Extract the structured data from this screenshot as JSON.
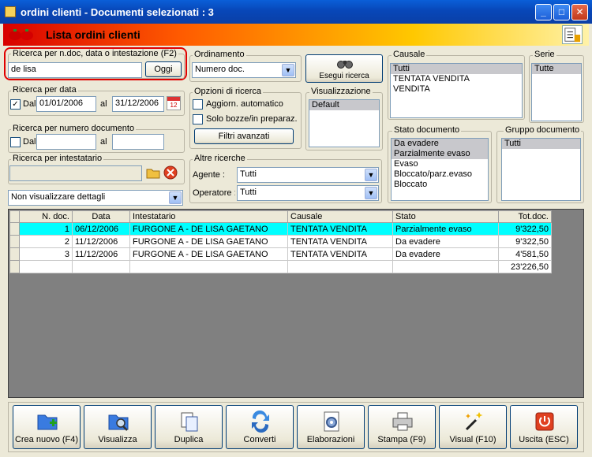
{
  "window": {
    "title": "ordini clienti - Documenti selezionati : 3",
    "controls": {
      "minimize": "_",
      "maximize": "□",
      "close": "✕"
    }
  },
  "header": {
    "title": "Lista ordini clienti"
  },
  "search_text": {
    "label": "Ricerca per n.doc, data o intestazione (F2)",
    "value": "de lisa",
    "today_button": "Oggi"
  },
  "sort": {
    "label": "Ordinamento",
    "value": "Numero doc."
  },
  "run_search": {
    "label": "Esegui ricerca"
  },
  "causale": {
    "label": "Causale",
    "items": [
      "Tutti",
      "TENTATA VENDITA",
      "VENDITA"
    ],
    "selected": 0
  },
  "serie": {
    "label": "Serie",
    "items": [
      "Tutte"
    ],
    "selected": 0
  },
  "date_search": {
    "label": "Ricerca per data",
    "from_label": "Dal",
    "from_value": "01/01/2006",
    "to_label": "al",
    "to_value": "31/12/2006",
    "checked": true,
    "calendar_icon_text": "12"
  },
  "options": {
    "label": "Opzioni di ricerca",
    "auto_update": "Aggiorn. automatico",
    "drafts_only": "Solo bozze/in preparaz.",
    "advanced_filters": "Filtri avanzati"
  },
  "view": {
    "label": "Visualizzazione",
    "items": [
      "Default"
    ],
    "selected": 0
  },
  "doc_number_search": {
    "label": "Ricerca per numero documento",
    "from_label": "Dal",
    "to_label": "al"
  },
  "stato": {
    "label": "Stato documento",
    "items": [
      "Da evadere",
      "Parzialmente evaso",
      "Evaso",
      "Bloccato/parz.evaso",
      "Bloccato"
    ],
    "selected": [
      0,
      1
    ]
  },
  "gruppo": {
    "label": "Gruppo documento",
    "items": [
      "Tutti"
    ],
    "selected": 0
  },
  "holder_search": {
    "label": "Ricerca per intestatario"
  },
  "other_search": {
    "label": "Altre ricerche",
    "agent_label": "Agente :",
    "agent_value": "Tutti",
    "operator_label": "Operatore :",
    "operator_value": "Tutti"
  },
  "details": {
    "value": "Non visualizzare dettagli"
  },
  "grid": {
    "columns": [
      "N. doc.",
      "Data",
      "Intestatario",
      "Causale",
      "Stato",
      "Tot.doc."
    ],
    "rows": [
      [
        "1",
        "06/12/2006",
        "FURGONE A - DE LISA GAETANO",
        "TENTATA VENDITA",
        "Parzialmente evaso",
        "9'322,50"
      ],
      [
        "2",
        "11/12/2006",
        "FURGONE A - DE LISA GAETANO",
        "TENTATA VENDITA",
        "Da evadere",
        "9'322,50"
      ],
      [
        "3",
        "11/12/2006",
        "FURGONE A - DE LISA GAETANO",
        "TENTATA VENDITA",
        "Da evadere",
        "4'581,50"
      ]
    ],
    "total": "23'226,50"
  },
  "toolbar": {
    "buttons": [
      {
        "label": "Crea nuovo (F4)",
        "icon": "new-folder-icon"
      },
      {
        "label": "Visualizza",
        "icon": "view-folder-icon"
      },
      {
        "label": "Duplica",
        "icon": "duplicate-icon"
      },
      {
        "label": "Converti",
        "icon": "convert-icon"
      },
      {
        "label": "Elaborazioni",
        "icon": "processing-icon"
      },
      {
        "label": "Stampa (F9)",
        "icon": "printer-icon"
      },
      {
        "label": "Visual (F10)",
        "icon": "magic-wand-icon"
      },
      {
        "label": "Uscita (ESC)",
        "icon": "power-icon"
      }
    ]
  }
}
